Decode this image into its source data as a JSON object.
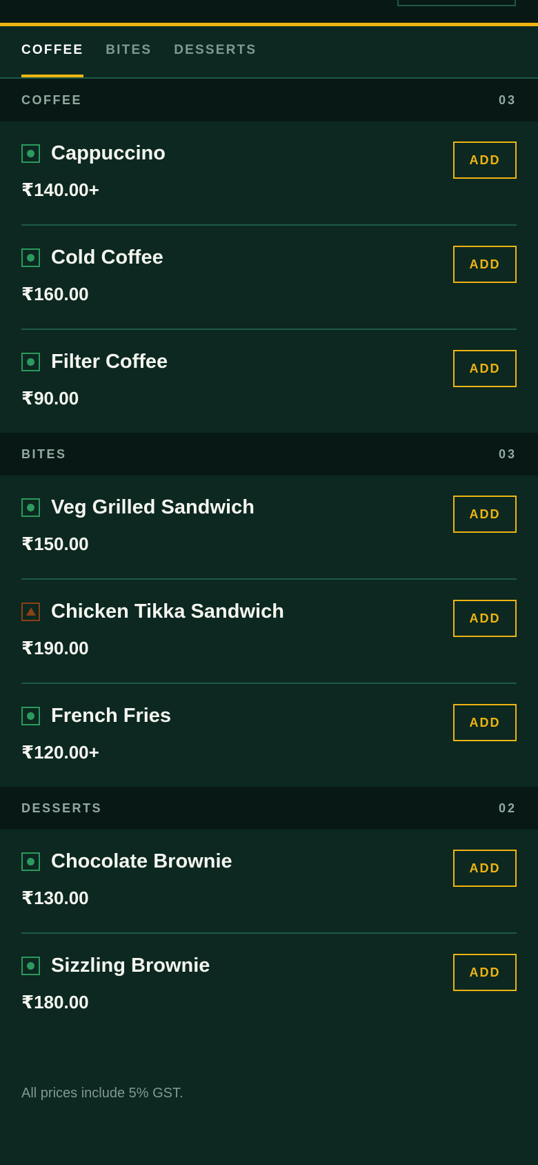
{
  "tabs": [
    {
      "label": "COFFEE",
      "active": true
    },
    {
      "label": "BITES",
      "active": false
    },
    {
      "label": "DESSERTS",
      "active": false
    }
  ],
  "categories": [
    {
      "name": "COFFEE",
      "count": "03",
      "items": [
        {
          "name": "Cappuccino",
          "price": "₹140.00+",
          "diet": "veg",
          "add_label": "ADD"
        },
        {
          "name": "Cold Coffee",
          "price": "₹160.00",
          "diet": "veg",
          "add_label": "ADD"
        },
        {
          "name": "Filter Coffee",
          "price": "₹90.00",
          "diet": "veg",
          "add_label": "ADD"
        }
      ]
    },
    {
      "name": "BITES",
      "count": "03",
      "items": [
        {
          "name": "Veg Grilled Sandwich",
          "price": "₹150.00",
          "diet": "veg",
          "add_label": "ADD"
        },
        {
          "name": "Chicken Tikka Sandwich",
          "price": "₹190.00",
          "diet": "non-veg",
          "add_label": "ADD"
        },
        {
          "name": "French Fries",
          "price": "₹120.00+",
          "diet": "veg",
          "add_label": "ADD"
        }
      ]
    },
    {
      "name": "DESSERTS",
      "count": "02",
      "items": [
        {
          "name": "Chocolate Brownie",
          "price": "₹130.00",
          "diet": "veg",
          "add_label": "ADD"
        },
        {
          "name": "Sizzling Brownie",
          "price": "₹180.00",
          "diet": "veg",
          "add_label": "ADD"
        }
      ]
    }
  ],
  "footer": {
    "note": "All prices include 5% GST."
  },
  "colors": {
    "background": "#0c2820",
    "header_band": "#081915",
    "accent": "#f0b412",
    "divider": "#1e5a45",
    "veg": "#2c9a5e",
    "non_veg": "#8b4214"
  },
  "icons": {
    "veg": "veg-indicator-icon",
    "non_veg": "non-veg-indicator-icon"
  }
}
